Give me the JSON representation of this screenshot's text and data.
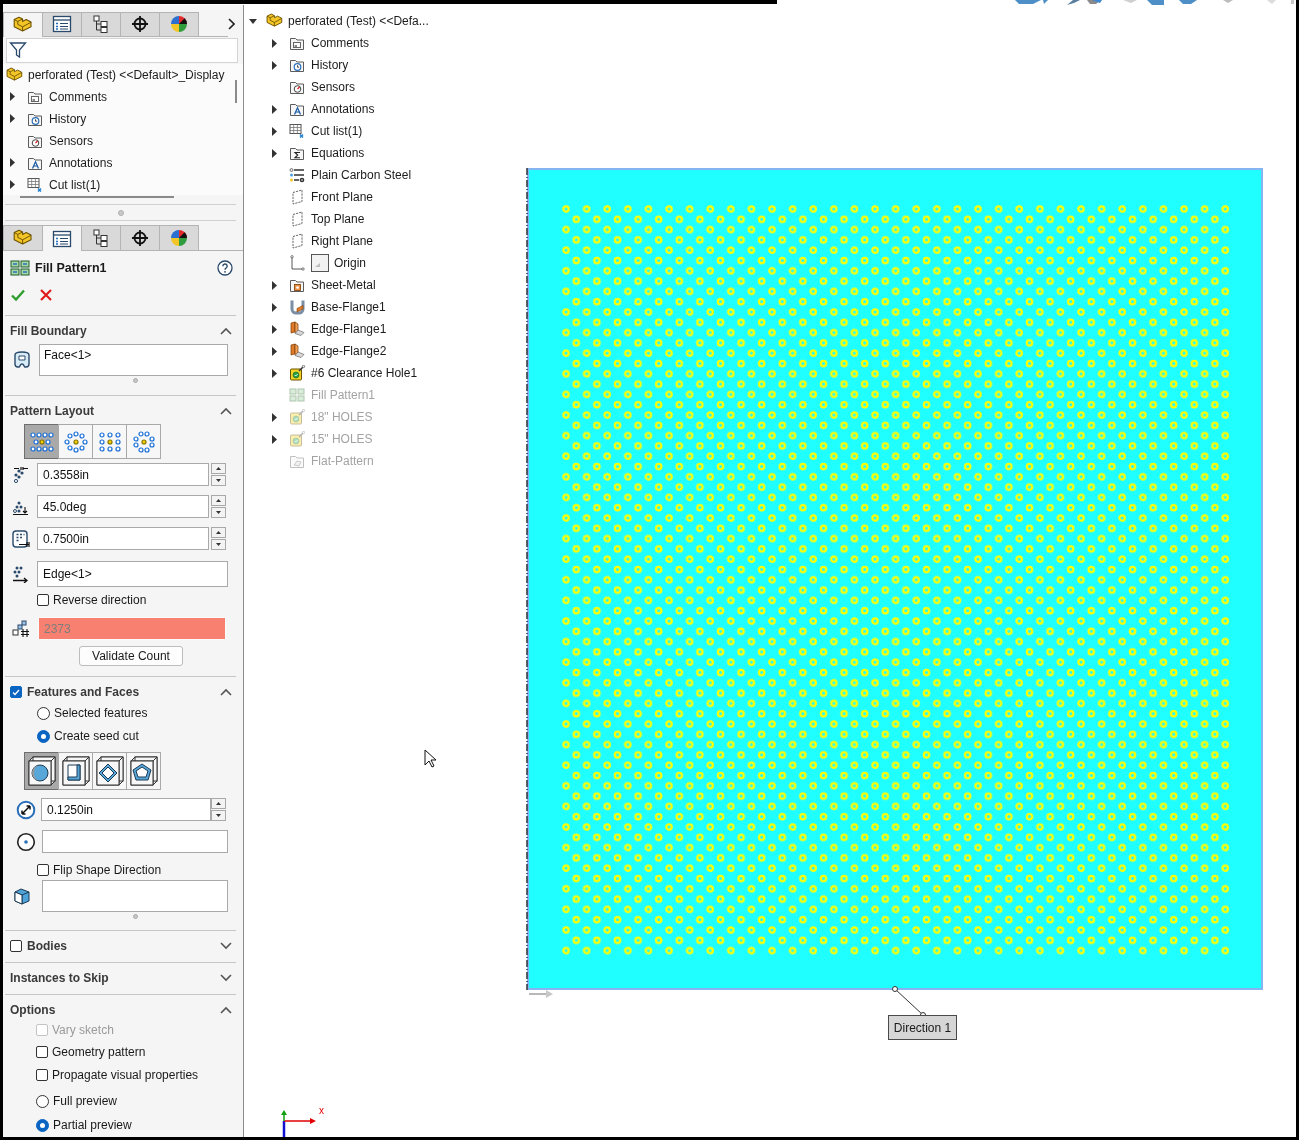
{
  "feature_manager": {
    "tabs": [
      {
        "kind": "feature_tree",
        "selected": true
      },
      {
        "kind": "property_manager",
        "selected": false
      },
      {
        "kind": "configuration_manager",
        "selected": false
      },
      {
        "kind": "dimxpert",
        "selected": false
      },
      {
        "kind": "display_manager",
        "selected": false
      }
    ],
    "tree": {
      "label": "perforated (Test) <<Default>_Display",
      "kind": "part",
      "dimmed": false,
      "children": [
        {
          "label": "Comments",
          "kind": "comments",
          "expanded": false,
          "dimmed": false
        },
        {
          "label": "History",
          "kind": "history",
          "expanded": false,
          "dimmed": false
        },
        {
          "label": "Sensors",
          "kind": "sensors",
          "dimmed": false
        },
        {
          "label": "Annotations",
          "kind": "annotations",
          "expanded": false,
          "dimmed": false
        },
        {
          "label": "Cut list(1)",
          "kind": "cut_list",
          "expanded": false,
          "dimmed": false
        }
      ]
    }
  },
  "property_manager": {
    "tabs": [
      {
        "kind": "feature_tree",
        "selected": false
      },
      {
        "kind": "property_manager",
        "selected": true
      },
      {
        "kind": "configuration_manager",
        "selected": false
      },
      {
        "kind": "dimxpert",
        "selected": false
      },
      {
        "kind": "display_manager",
        "selected": false
      }
    ],
    "title": "Fill Pattern1",
    "sections": [
      {
        "kind": "fill_boundary",
        "title": "Fill Boundary",
        "expanded": true,
        "selection": "Face<1>"
      },
      {
        "kind": "pattern_layout",
        "title": "Pattern Layout",
        "expanded": true,
        "layouts": [
          {
            "kind": "perforation",
            "selected": true
          },
          {
            "kind": "circular",
            "selected": false
          },
          {
            "kind": "square",
            "selected": false
          },
          {
            "kind": "polygon",
            "selected": false
          }
        ],
        "values": [
          {
            "kind": "spacing",
            "value": "0.3558in"
          },
          {
            "kind": "angle",
            "value": "45.0deg"
          },
          {
            "kind": "margin",
            "value": "0.7500in"
          }
        ],
        "direction": "Edge<1>",
        "reverse": {
          "label": "Reverse direction",
          "checked": false
        },
        "count": {
          "value": "2373",
          "invalid": true
        },
        "validate": "Validate Count"
      },
      {
        "kind": "features_and_faces",
        "title": "Features and Faces",
        "checked": true,
        "expanded": true,
        "sources": [
          {
            "label": "Selected features",
            "selected": false
          },
          {
            "label": "Create seed cut",
            "selected": true
          }
        ],
        "shapes": [
          {
            "kind": "circle",
            "selected": true
          },
          {
            "kind": "square",
            "selected": false
          },
          {
            "kind": "diamond",
            "selected": false
          },
          {
            "kind": "polygon",
            "selected": false
          }
        ],
        "diameter": "0.1250in",
        "flip": {
          "label": "Flip Shape Direction",
          "checked": false
        }
      },
      {
        "kind": "bodies",
        "title": "Bodies",
        "checked": false,
        "expanded": false
      },
      {
        "kind": "instances_to_skip",
        "title": "Instances to Skip",
        "expanded": false
      },
      {
        "kind": "options",
        "title": "Options",
        "expanded": true,
        "checks": [
          {
            "label": "Vary sketch",
            "checked": false,
            "disabled": true
          },
          {
            "label": "Geometry pattern",
            "checked": false,
            "disabled": false
          },
          {
            "label": "Propagate visual properties",
            "checked": false,
            "disabled": false
          }
        ],
        "previews": [
          {
            "label": "Full preview",
            "selected": false
          },
          {
            "label": "Partial preview",
            "selected": true
          }
        ]
      }
    ]
  },
  "flyout_tree": {
    "label": "perforated (Test) <<Defa...",
    "kind": "part",
    "expanded": true,
    "dimmed": false,
    "children": [
      {
        "label": "Comments",
        "kind": "comments",
        "expanded": false,
        "dimmed": false
      },
      {
        "label": "History",
        "kind": "history",
        "expanded": false,
        "dimmed": false
      },
      {
        "label": "Sensors",
        "kind": "sensors",
        "dimmed": false
      },
      {
        "label": "Annotations",
        "kind": "annotations",
        "expanded": false,
        "dimmed": false
      },
      {
        "label": "Cut list(1)",
        "kind": "cut_list",
        "expanded": false,
        "dimmed": false
      },
      {
        "label": "Equations",
        "kind": "equations",
        "expanded": false,
        "dimmed": false
      },
      {
        "label": "Plain Carbon Steel",
        "kind": "material",
        "dimmed": false
      },
      {
        "label": "Front Plane",
        "kind": "plane",
        "dimmed": false
      },
      {
        "label": "Top Plane",
        "kind": "plane",
        "dimmed": false
      },
      {
        "label": "Right Plane",
        "kind": "plane",
        "dimmed": false
      },
      {
        "label": "Origin",
        "kind": "origin",
        "dimmed": false
      },
      {
        "label": "Sheet-Metal",
        "kind": "sheet_metal",
        "expanded": false,
        "dimmed": false
      },
      {
        "label": "Base-Flange1",
        "kind": "base_flange",
        "expanded": false,
        "dimmed": false
      },
      {
        "label": "Edge-Flange1",
        "kind": "edge_flange",
        "expanded": false,
        "dimmed": false
      },
      {
        "label": "Edge-Flange2",
        "kind": "edge_flange",
        "expanded": false,
        "dimmed": false
      },
      {
        "label": "#6 Clearance Hole1",
        "kind": "hole",
        "expanded": false,
        "dimmed": false
      },
      {
        "label": "Fill Pattern1",
        "kind": "fill_pattern",
        "dimmed": true
      },
      {
        "label": "18\" HOLES",
        "kind": "hole",
        "expanded": false,
        "dimmed": true
      },
      {
        "label": "15\" HOLES",
        "kind": "hole",
        "expanded": false,
        "dimmed": true
      },
      {
        "label": "Flat-Pattern",
        "kind": "flat_pattern",
        "dimmed": true
      }
    ]
  },
  "graphics": {
    "callout": "Direction 1",
    "triad_label": "x"
  }
}
